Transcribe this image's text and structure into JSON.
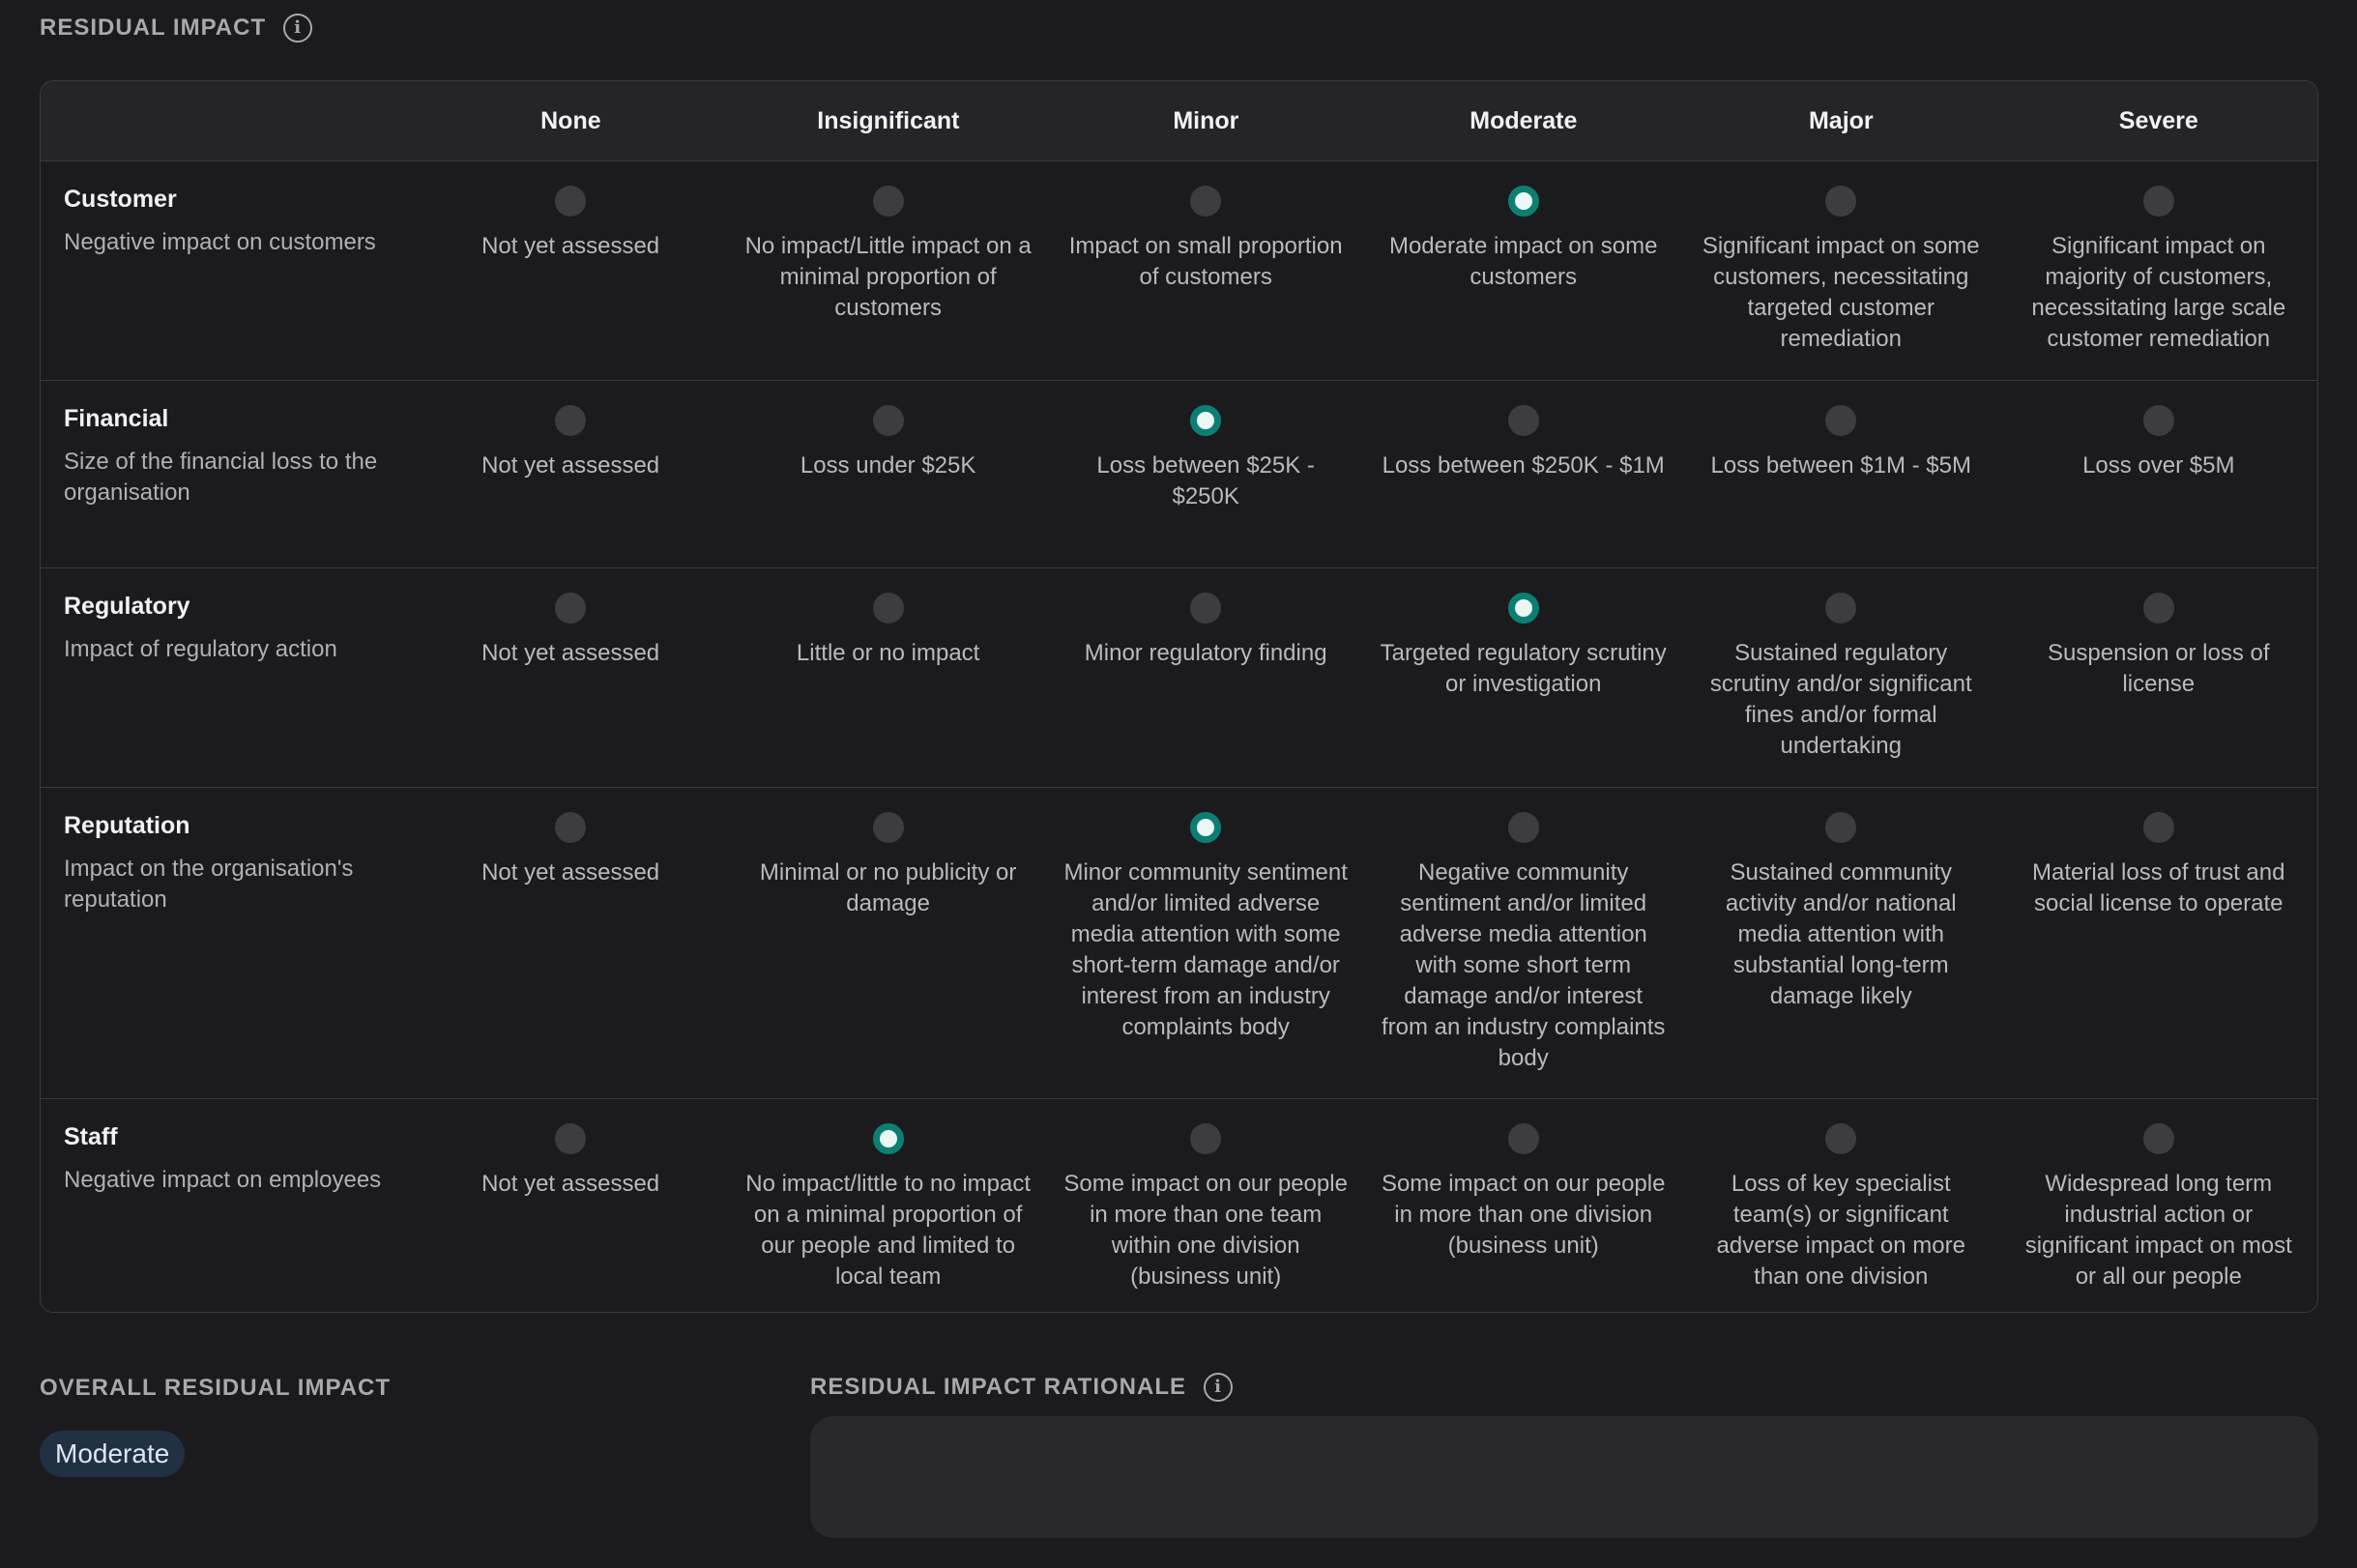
{
  "residual_impact": {
    "title": "RESIDUAL IMPACT",
    "columns": [
      "None",
      "Insignificant",
      "Minor",
      "Moderate",
      "Major",
      "Severe"
    ],
    "rows": [
      {
        "name": "Customer",
        "description": "Negative impact on customers",
        "selected": 3,
        "cells": [
          "Not yet assessed",
          "No impact/Little impact on a minimal proportion of customers",
          "Impact on small proportion of customers",
          "Moderate impact on some customers",
          "Significant impact on some customers, necessitating targeted customer remediation",
          "Significant impact on majority of customers, necessitating large scale customer remediation"
        ]
      },
      {
        "name": "Financial",
        "description": "Size of the financial loss to the organisation",
        "selected": 2,
        "cells": [
          "Not yet assessed",
          "Loss under $25K",
          "Loss between $25K - $250K",
          "Loss between $250K - $1M",
          "Loss between $1M - $5M",
          "Loss over $5M"
        ]
      },
      {
        "name": "Regulatory",
        "description": "Impact of regulatory action",
        "selected": 3,
        "cells": [
          "Not yet assessed",
          "Little or no impact",
          "Minor regulatory finding",
          "Targeted regulatory scrutiny or investigation",
          "Sustained regulatory scrutiny and/or significant fines and/or formal undertaking",
          "Suspension or loss of license"
        ]
      },
      {
        "name": "Reputation",
        "description": "Impact on the organisation's reputation",
        "selected": 2,
        "cells": [
          "Not yet assessed",
          "Minimal or no publicity or damage",
          "Minor community sentiment and/or limited adverse media attention with some short-term damage and/or interest from an industry complaints body",
          "Negative community sentiment and/or limited adverse media attention with some short term damage and/or interest from an industry complaints body",
          "Sustained community activity and/or national media attention with substantial long-term damage likely",
          "Material loss of trust and social license to operate"
        ]
      },
      {
        "name": "Staff",
        "description": "Negative impact on employees",
        "selected": 1,
        "cells": [
          "Not yet assessed",
          "No impact/little to no impact on a minimal proportion of our people and limited to local team",
          "Some impact on our people in more than one team within one division (business unit)",
          "Some impact on our people in more than one division (business unit)",
          "Loss of key specialist team(s) or significant adverse impact on more than one division",
          "Widespread long term industrial action or significant impact on most or all our people"
        ]
      }
    ]
  },
  "overall": {
    "title": "OVERALL RESIDUAL IMPACT",
    "value": "Moderate"
  },
  "rationale": {
    "title": "RESIDUAL IMPACT RATIONALE",
    "value": ""
  },
  "colors": {
    "background": "#1b1b1d",
    "accent": "#0c7f72",
    "badge": "#223044"
  },
  "icons": {
    "info": "info-icon"
  }
}
